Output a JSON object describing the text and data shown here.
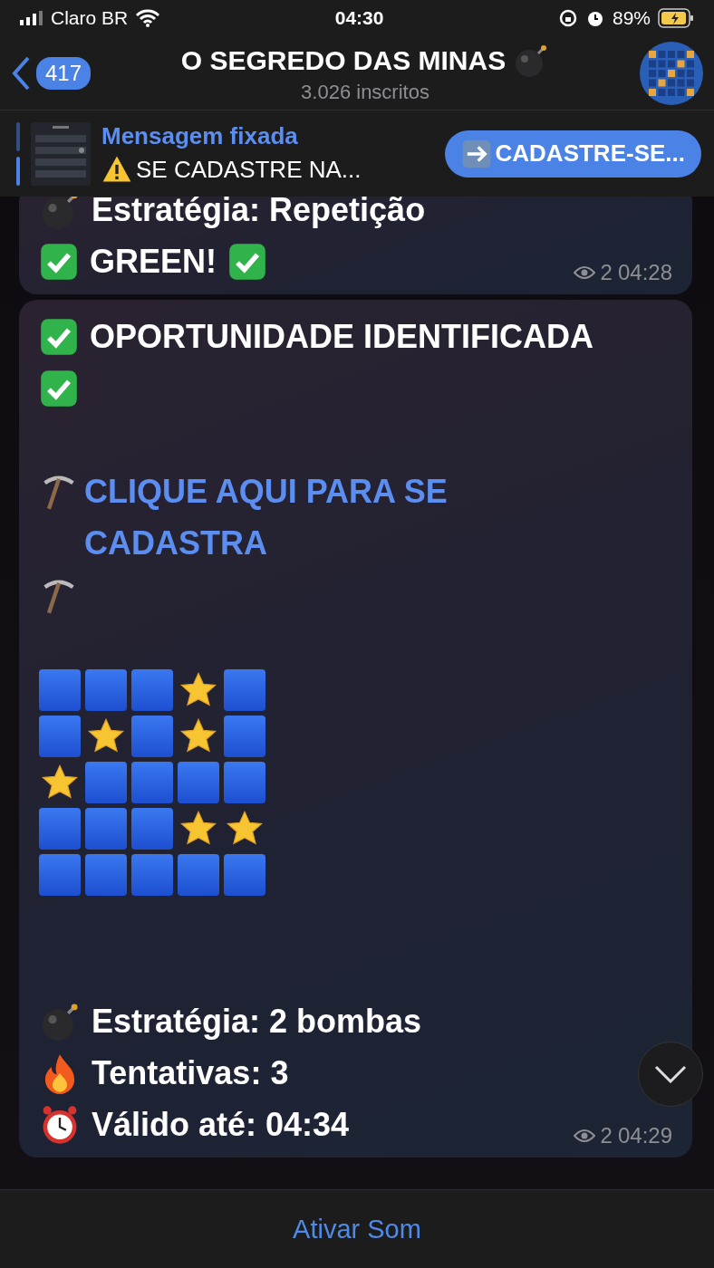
{
  "status_bar": {
    "carrier": "Claro BR",
    "time": "04:30",
    "battery": "89%"
  },
  "header": {
    "back_count": "417",
    "title": "O SEGREDO DAS MINAS",
    "subtitle": "3.026 inscritos"
  },
  "pinned": {
    "title": "Mensagem fixada",
    "text": "SE CADASTRE NA...",
    "button": "CADASTRE-SE..."
  },
  "messages": [
    {
      "lines": [
        {
          "kind": "bomb",
          "text": "Estratégia: Repetição"
        },
        {
          "kind": "result",
          "text": "GREEN!"
        }
      ],
      "views": "2",
      "time": "04:28"
    },
    {
      "lines": [
        {
          "kind": "headline",
          "text": "OPORTUNIDADE IDENTIFICADA"
        },
        {
          "kind": "link",
          "text": "CLIQUE AQUI PARA SE CADASTRA"
        },
        {
          "kind": "grid"
        },
        {
          "kind": "bomb",
          "text": "Estratégia:  2 bombas"
        },
        {
          "kind": "fire",
          "text": "Tentativas: 3"
        },
        {
          "kind": "clock",
          "text": "Válido até: 04:34"
        }
      ],
      "grid": [
        [
          {
            "kind": "square"
          },
          {
            "kind": "square"
          },
          {
            "kind": "square"
          },
          {
            "kind": "star"
          },
          {
            "kind": "square"
          }
        ],
        [
          {
            "kind": "square"
          },
          {
            "kind": "star"
          },
          {
            "kind": "square"
          },
          {
            "kind": "star"
          },
          {
            "kind": "square"
          }
        ],
        [
          {
            "kind": "star"
          },
          {
            "kind": "square"
          },
          {
            "kind": "square"
          },
          {
            "kind": "square"
          },
          {
            "kind": "square"
          }
        ],
        [
          {
            "kind": "square"
          },
          {
            "kind": "square"
          },
          {
            "kind": "square"
          },
          {
            "kind": "star"
          },
          {
            "kind": "star"
          }
        ],
        [
          {
            "kind": "square"
          },
          {
            "kind": "square"
          },
          {
            "kind": "square"
          },
          {
            "kind": "square"
          },
          {
            "kind": "square"
          }
        ]
      ],
      "views": "2",
      "time": "04:29"
    }
  ],
  "bottom_button": "Ativar Som"
}
